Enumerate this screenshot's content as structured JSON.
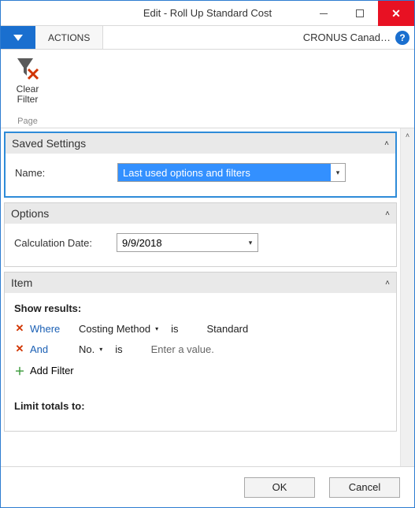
{
  "window": {
    "title": "Edit - Roll Up Standard Cost"
  },
  "ribbon": {
    "tab1": "ACTIONS",
    "company": "CRONUS Canad…"
  },
  "toolbar": {
    "clearFilter": {
      "line1": "Clear",
      "line2": "Filter"
    },
    "sectionLabel": "Page"
  },
  "sections": {
    "savedSettings": {
      "title": "Saved Settings",
      "nameLabel": "Name:",
      "nameValue": "Last used options and filters"
    },
    "options": {
      "title": "Options",
      "calcDateLabel": "Calculation Date:",
      "calcDateValue": "9/9/2018"
    },
    "item": {
      "title": "Item",
      "showResults": "Show results:",
      "filters": [
        {
          "conj": "Where",
          "field": "Costing Method",
          "op": "is",
          "value": "Standard",
          "placeholder": false
        },
        {
          "conj": "And",
          "field": "No.",
          "op": "is",
          "value": "Enter a value.",
          "placeholder": true
        }
      ],
      "addFilter": "Add Filter",
      "limitTotals": "Limit totals to:"
    }
  },
  "footer": {
    "ok": "OK",
    "cancel": "Cancel"
  }
}
